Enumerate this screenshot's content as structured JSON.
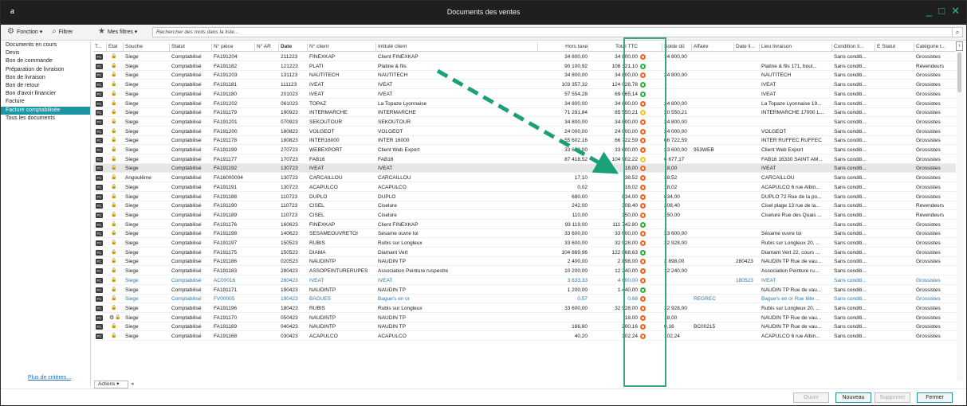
{
  "window": {
    "logo": "a",
    "title": "Documents des ventes",
    "minimize": "_",
    "maximize": "□",
    "close": "✕"
  },
  "toolbar": {
    "fonction_label": "Fonction ▾",
    "filtrer_label": "Filtrer",
    "mes_filtres_label": "Mes filtres ▾",
    "search_placeholder": "Rechercher des mots dans la liste..."
  },
  "sidebar": {
    "items": [
      {
        "label": "Documents en cours",
        "active": false
      },
      {
        "label": "Devis",
        "active": false
      },
      {
        "label": "Bon de commande",
        "active": false
      },
      {
        "label": "Préparation de livraison",
        "active": false
      },
      {
        "label": "Bon de livraison",
        "active": false
      },
      {
        "label": "Bon de retour",
        "active": false
      },
      {
        "label": "Bon d'avoir financier",
        "active": false
      },
      {
        "label": "Facture",
        "active": false
      },
      {
        "label": "Facture comptabilisée",
        "active": true
      },
      {
        "label": "Tous les documents",
        "active": false
      }
    ],
    "more_criteria": "Plus de critères..."
  },
  "columns": {
    "type": "T...",
    "etat": "Etat",
    "souche": "Souche",
    "statut": "Statut",
    "piece": "N° pièce",
    "ar": "N° AR",
    "date": "Date",
    "client": "N° client",
    "intitule": "Intitulé client",
    "ht": "Hors taxe",
    "ttc": "Total TTC",
    "solde": "Solde dû",
    "affaire": "Affaire",
    "datel": "Date li...",
    "lieu": "Lieu livraison",
    "condition": "Condition li...",
    "estatut": "E Statut",
    "categorie": "Catégorie t..."
  },
  "rows": [
    {
      "souche": "Siege",
      "statut": "Comptabilisé",
      "piece": "FA191204",
      "date": "211223",
      "client": "FINEXKAP",
      "intitule": "Client FINEXKAP",
      "ht": "34 800,00",
      "ttc": "34 800,00",
      "dot": "orange",
      "solde": "34 800,00",
      "affaire": "",
      "datel": "",
      "lieu": "",
      "condition": "Sans conditi...",
      "categorie": "Grossistes"
    },
    {
      "souche": "Siege",
      "statut": "Comptabilisé",
      "piece": "FA191182",
      "date": "121223",
      "client": "PLATI",
      "intitule": "Platine & fils",
      "ht": "90 100,92",
      "ttc": "108 121,10",
      "dot": "green",
      "solde": "",
      "affaire": "",
      "datel": "",
      "lieu": "Platine & fils 171, boul...",
      "condition": "Sans conditi...",
      "categorie": "Revendeurs"
    },
    {
      "souche": "Siege",
      "statut": "Comptabilisé",
      "piece": "FA191203",
      "date": "131123",
      "client": "NAUTITECH",
      "intitule": "NAUTITECH",
      "ht": "34 800,00",
      "ttc": "34 800,00",
      "dot": "orange",
      "solde": "34 800,00",
      "affaire": "",
      "datel": "",
      "lieu": "NAUTITECH",
      "condition": "Sans conditi...",
      "categorie": "Grossistes"
    },
    {
      "souche": "Siege",
      "statut": "Comptabilisé",
      "piece": "FA191181",
      "date": "111123",
      "client": "IVEAT",
      "intitule": "IVEAT",
      "ht": "103 357,32",
      "ttc": "124 028,78",
      "dot": "green",
      "solde": "",
      "affaire": "",
      "datel": "",
      "lieu": "IVEAT",
      "condition": "Sans conditi...",
      "categorie": "Grossistes"
    },
    {
      "souche": "Siege",
      "statut": "Comptabilisé",
      "piece": "FA191180",
      "date": "201023",
      "client": "IVEAT",
      "intitule": "IVEAT",
      "ht": "57 554,28",
      "ttc": "69 065,14",
      "dot": "green",
      "solde": "",
      "affaire": "",
      "datel": "",
      "lieu": "IVEAT",
      "condition": "Sans conditi...",
      "categorie": "Grossistes"
    },
    {
      "souche": "Siege",
      "statut": "Comptabilisé",
      "piece": "FA191202",
      "date": "061023",
      "client": "TOPAZ",
      "intitule": "La Topaze Lyonnaise",
      "ht": "34 800,00",
      "ttc": "34 800,00",
      "dot": "orange",
      "solde": "34 800,00",
      "affaire": "",
      "datel": "",
      "lieu": "La Topaze Lyonnaise 19...",
      "condition": "Sans conditi...",
      "categorie": "Grossistes"
    },
    {
      "souche": "Siege",
      "statut": "Comptabilisé",
      "piece": "FA191179",
      "date": "190923",
      "client": "INTERMARCHE",
      "intitule": "INTERMARCHE",
      "ht": "71 291,84",
      "ttc": "85 550,21",
      "dot": "yellow",
      "solde": "20 550,21",
      "affaire": "",
      "datel": "",
      "lieu": "INTERMARCHE 17000 L...",
      "condition": "Sans conditi...",
      "categorie": "Grossistes"
    },
    {
      "souche": "Siege",
      "statut": "Comptabilisé",
      "piece": "FA191201",
      "date": "070923",
      "client": "SEKOUTOUR",
      "intitule": "SEKOUTOUR",
      "ht": "34 800,00",
      "ttc": "34 800,00",
      "dot": "orange",
      "solde": "34 800,00",
      "affaire": "",
      "datel": "",
      "lieu": "",
      "condition": "Sans conditi...",
      "categorie": "Grossistes"
    },
    {
      "souche": "Siege",
      "statut": "Comptabilisé",
      "piece": "FA191200",
      "date": "180823",
      "client": "VOLGEOT",
      "intitule": "VOLGEOT",
      "ht": "24 000,00",
      "ttc": "24 000,00",
      "dot": "orange",
      "solde": "24 000,00",
      "affaire": "",
      "datel": "",
      "lieu": "VOLGEOT",
      "condition": "Sans conditi...",
      "categorie": "Grossistes"
    },
    {
      "souche": "Siege",
      "statut": "Comptabilisé",
      "piece": "FA191178",
      "date": "180823",
      "client": "INTER16000",
      "intitule": "INTER 16000",
      "ht": "55 602,16",
      "ttc": "66 722,59",
      "dot": "orange",
      "solde": "66 722,59",
      "affaire": "",
      "datel": "",
      "lieu": "INTER RUFFEC RUFFEC",
      "condition": "Sans conditi...",
      "categorie": "Grossistes"
    },
    {
      "souche": "Siege",
      "statut": "Comptabilisé",
      "piece": "FA191199",
      "date": "270723",
      "client": "WEBEXPORT",
      "intitule": "Client Web Export",
      "ht": "33 600,00",
      "ttc": "33 600,00",
      "dot": "orange",
      "solde": "33 600,00",
      "affaire": "953WEB",
      "datel": "",
      "lieu": "Client Web Export",
      "condition": "Sans conditi...",
      "categorie": "Grossistes"
    },
    {
      "souche": "Siege",
      "statut": "Comptabilisé",
      "piece": "FA191177",
      "date": "170723",
      "client": "FAB16",
      "intitule": "FAB16",
      "ht": "87 418,52",
      "ttc": "104 902,22",
      "dot": "yellow",
      "solde": "6 677,17",
      "affaire": "",
      "datel": "",
      "lieu": "FAB16 16330 SAINT AM...",
      "condition": "Sans conditi...",
      "categorie": "Grossistes"
    },
    {
      "souche": "Siege",
      "statut": "Comptabilisé",
      "piece": "FA191192",
      "date": "130723",
      "client": "IVEAT",
      "intitule": "IVEAT",
      "ht": "",
      "ttc": "18,00",
      "dot": "orange",
      "solde": "18,00",
      "affaire": "",
      "datel": "",
      "lieu": "IVEAT",
      "condition": "Sans conditi...",
      "categorie": "Grossistes",
      "selected": true
    },
    {
      "souche": "Angoulême",
      "statut": "Comptabilisé",
      "piece": "FA16000004",
      "date": "130723",
      "client": "CARCAILLOU",
      "intitule": "CARCAILLOU",
      "ht": "17,10",
      "ttc": "38,52",
      "dot": "orange",
      "solde": "38,52",
      "affaire": "",
      "datel": "",
      "lieu": "CARCAILLOU",
      "condition": "Sans conditi...",
      "categorie": "Grossistes"
    },
    {
      "souche": "Siege",
      "statut": "Comptabilisé",
      "piece": "FA191191",
      "date": "130723",
      "client": "ACAPULCO",
      "intitule": "ACAPULCO",
      "ht": "0,02",
      "ttc": "18,02",
      "dot": "orange",
      "solde": "18,02",
      "affaire": "",
      "datel": "",
      "lieu": "ACAPULCO 6 rue Albin...",
      "condition": "Sans conditi...",
      "categorie": "Grossistes"
    },
    {
      "souche": "Siege",
      "statut": "Comptabilisé",
      "piece": "FA191188",
      "date": "110723",
      "client": "DUPLO",
      "intitule": "DUPLO",
      "ht": "680,00",
      "ttc": "834,00",
      "dot": "orange",
      "solde": "834,00",
      "affaire": "",
      "datel": "",
      "lieu": "DUPLO 72 Rue de la po...",
      "condition": "Sans conditi...",
      "categorie": "Grossistes"
    },
    {
      "souche": "Siege",
      "statut": "Comptabilisé",
      "piece": "FA191190",
      "date": "110723",
      "client": "CISEL",
      "intitule": "Ciselure",
      "ht": "242,00",
      "ttc": "308,40",
      "dot": "orange",
      "solde": "308,40",
      "affaire": "",
      "datel": "",
      "lieu": "Cisel plage 13 rue de la...",
      "condition": "Sans conditi...",
      "categorie": "Revendeurs"
    },
    {
      "souche": "Siege",
      "statut": "Comptabilisé",
      "piece": "FA191189",
      "date": "110723",
      "client": "CISEL",
      "intitule": "Ciselure",
      "ht": "110,00",
      "ttc": "150,00",
      "dot": "orange",
      "solde": "150,00",
      "affaire": "",
      "datel": "",
      "lieu": "Ciselure Rue des Quais ...",
      "condition": "Sans conditi...",
      "categorie": "Revendeurs"
    },
    {
      "souche": "Siege",
      "statut": "Comptabilisé",
      "piece": "FA191176",
      "date": "160623",
      "client": "FINEXKAP",
      "intitule": "Client FINEXKAP",
      "ht": "93 119,00",
      "ttc": "111 742,80",
      "dot": "green",
      "solde": "",
      "affaire": "",
      "datel": "",
      "lieu": "",
      "condition": "Sans conditi...",
      "categorie": "Grossistes"
    },
    {
      "souche": "Siege",
      "statut": "Comptabilisé",
      "piece": "FA191198",
      "date": "140623",
      "client": "SESAMEOUVRETOI",
      "intitule": "Sésame ouvre toi",
      "ht": "33 600,00",
      "ttc": "33 600,00",
      "dot": "orange",
      "solde": "33 600,00",
      "affaire": "",
      "datel": "",
      "lieu": "Sésame ouvre toi",
      "condition": "Sans conditi...",
      "categorie": "Grossistes"
    },
    {
      "souche": "Siege",
      "statut": "Comptabilisé",
      "piece": "FA191197",
      "date": "150523",
      "client": "RUBIS",
      "intitule": "Rubis sur Longleux",
      "ht": "33 600,00",
      "ttc": "32 928,00",
      "dot": "orange",
      "solde": "32 928,00",
      "affaire": "",
      "datel": "",
      "lieu": "Rubis sur Longleux 20, ...",
      "condition": "Sans conditi...",
      "categorie": "Grossistes"
    },
    {
      "souche": "Siege",
      "statut": "Comptabilisé",
      "piece": "FA191175",
      "date": "150523",
      "client": "DIAMA",
      "intitule": "Diamant Vert",
      "ht": "104 869,96",
      "ttc": "122 068,63",
      "dot": "green",
      "solde": "",
      "affaire": "",
      "datel": "",
      "lieu": "Diamant Vert 22, cours ...",
      "condition": "Sans conditi...",
      "categorie": "Grossistes"
    },
    {
      "souche": "Siege",
      "statut": "Comptabilisé",
      "piece": "FA191186",
      "date": "020523",
      "client": "NAUDINTP",
      "intitule": "NAUDIN TP",
      "ht": "2 400,00",
      "ttc": "2 898,00",
      "dot": "orange",
      "solde": "2 898,00",
      "affaire": "",
      "datel": "280423",
      "lieu": "NAUDIN TP Rue de vau...",
      "condition": "Sans conditi...",
      "categorie": "Grossistes"
    },
    {
      "souche": "Siege",
      "statut": "Comptabilisé",
      "piece": "FA191183",
      "date": "280423",
      "client": "ASSOPEINTURERUPES",
      "intitule": "Association Peinture ruspestre",
      "ht": "10 200,00",
      "ttc": "12 240,00",
      "dot": "orange",
      "solde": "12 240,00",
      "affaire": "",
      "datel": "",
      "lieu": "Association Peinture ru...",
      "condition": "Sans conditi...",
      "categorie": ""
    },
    {
      "souche": "Siege",
      "statut": "Comptabilisé",
      "piece": "AC00016",
      "date": "260423",
      "client": "IVEAT",
      "intitule": "IVEAT",
      "ht": "3 833,33",
      "ttc": "4 600,00",
      "dot": "orange",
      "solde": "",
      "affaire": "",
      "datel": "180523",
      "lieu": "IVEAT",
      "condition": "Sans conditi...",
      "categorie": "Grossistes",
      "blue": true
    },
    {
      "souche": "Siege",
      "statut": "Comptabilisé",
      "piece": "FA191171",
      "date": "190423",
      "client": "NAUDINTP",
      "intitule": "NAUDIN TP",
      "ht": "1 200,00",
      "ttc": "1 440,00",
      "dot": "green",
      "solde": "",
      "affaire": "",
      "datel": "",
      "lieu": "NAUDIN TP Rue de vau...",
      "condition": "Sans conditi...",
      "categorie": "Grossistes"
    },
    {
      "souche": "Siege",
      "statut": "Comptabilisé",
      "piece": "FV00005",
      "date": "190423",
      "client": "BAGUES",
      "intitule": "Bague's en or",
      "ht": "0,57",
      "ttc": "0,68",
      "dot": "orange",
      "solde": "",
      "affaire": "REGREC",
      "datel": "",
      "lieu": "Bague's en or Rue tête ...",
      "condition": "Sans conditi...",
      "categorie": "Grossistes",
      "blue": true
    },
    {
      "souche": "Siege",
      "statut": "Comptabilisé",
      "piece": "FA191196",
      "date": "180423",
      "client": "RUBIS",
      "intitule": "Rubis sur Longleux",
      "ht": "33 600,00",
      "ttc": "32 928,00",
      "dot": "orange",
      "solde": "32 928,00",
      "affaire": "",
      "datel": "",
      "lieu": "Rubis sur Longleux 20, ...",
      "condition": "Sans conditi...",
      "categorie": "Grossistes"
    },
    {
      "souche": "Siege",
      "statut": "Comptabilisé",
      "piece": "FA191170",
      "date": "050423",
      "client": "NAUDINTP",
      "intitule": "NAUDIN TP",
      "ht": "",
      "ttc": "18,00",
      "dot": "orange",
      "solde": "18,00",
      "affaire": "",
      "datel": "",
      "lieu": "NAUDIN TP Rue de vau...",
      "condition": "Sans conditi...",
      "categorie": "Grossistes",
      "extra_icon": true
    },
    {
      "souche": "Siege",
      "statut": "Comptabilisé",
      "piece": "FA191169",
      "date": "040423",
      "client": "NAUDINTP",
      "intitule": "NAUDIN TP",
      "ht": "166,80",
      "ttc": "200,16",
      "dot": "orange",
      "solde": "0,16",
      "affaire": "BC00215",
      "datel": "",
      "lieu": "NAUDIN TP Rue de vau...",
      "condition": "Sans conditi...",
      "categorie": "Grossistes"
    },
    {
      "souche": "Siege",
      "statut": "Comptabilisé",
      "piece": "FA191168",
      "date": "030423",
      "client": "ACAPULCO",
      "intitule": "ACAPULCO",
      "ht": "40,20",
      "ttc": "102,24",
      "dot": "orange",
      "solde": "102,24",
      "affaire": "",
      "datel": "",
      "lieu": "ACAPULCO 6 rue Albin...",
      "condition": "Sans conditi...",
      "categorie": "Grossistes"
    }
  ],
  "footer": {
    "actions_label": "Actions ▾",
    "ouvrir": "Ouvrir",
    "nouveau": "Nouveau",
    "supprimer": "Supprimer",
    "fermer": "Fermer"
  },
  "colors": {
    "accent": "#1c95a4",
    "highlight_box": "#3aa685",
    "arrow": "#1aa17a",
    "dot_orange": "#f0641e",
    "dot_green": "#2fae3c",
    "dot_yellow": "#f3c623"
  }
}
